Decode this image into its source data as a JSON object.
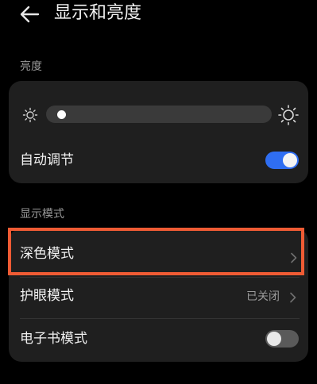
{
  "header": {
    "title": "显示和亮度",
    "back_icon": "back-arrow-icon"
  },
  "brightness": {
    "section_label": "亮度",
    "level": 0.03,
    "min_icon": "sun-small-icon",
    "max_icon": "sun-large-icon",
    "auto_adjust": {
      "label": "自动调节",
      "enabled": true
    }
  },
  "display_mode": {
    "section_label": "显示模式",
    "dark_mode": {
      "label": "深色模式",
      "chevron_icon": "chevron-right-icon"
    },
    "eye_comfort": {
      "label": "护眼模式",
      "value": "已关闭",
      "chevron_icon": "chevron-right-icon"
    },
    "ebook_mode": {
      "label": "电子书模式",
      "enabled": false
    }
  },
  "colors": {
    "background": "#000000",
    "card": "#1f1f1f",
    "toggle_on": "#2f6ef2",
    "toggle_off": "#5a5a5a",
    "highlight": "#ef5b34"
  }
}
